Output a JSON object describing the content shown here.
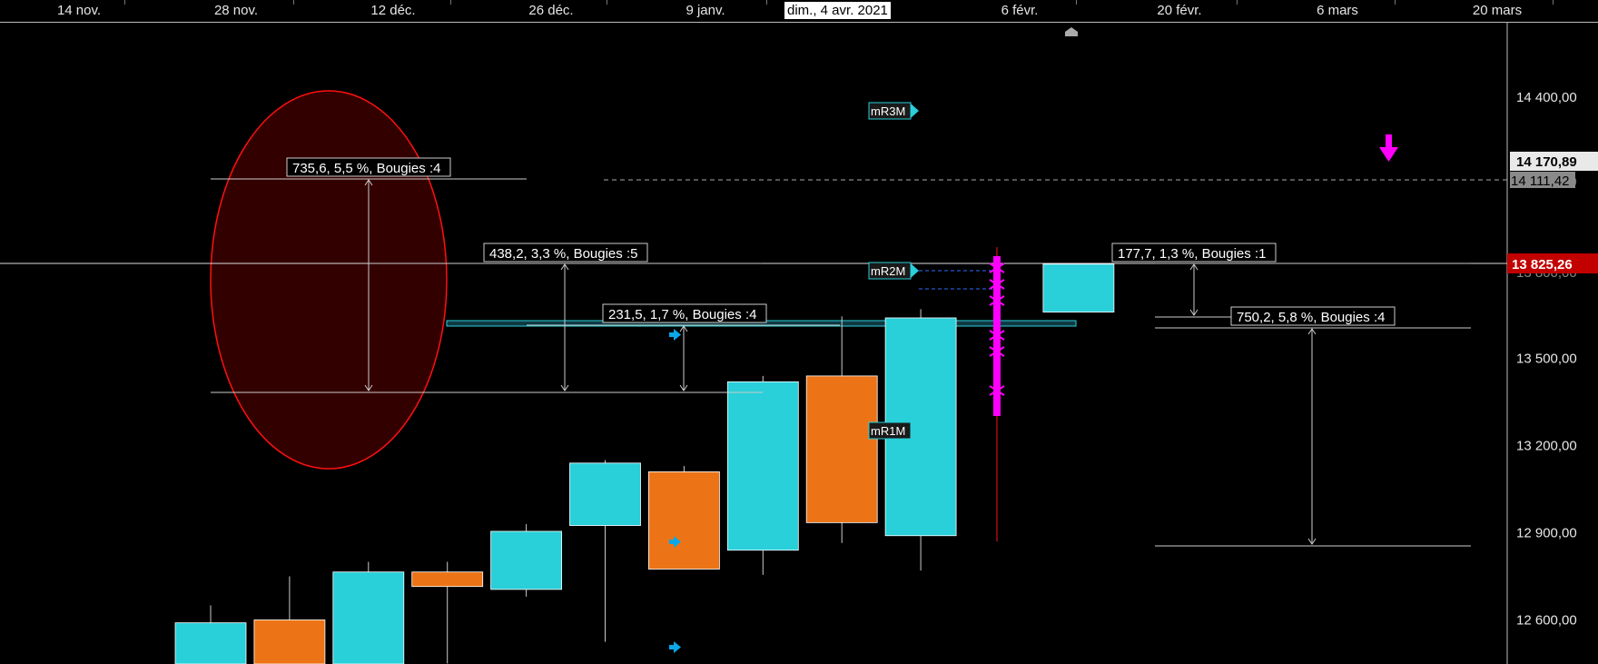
{
  "x_axis": {
    "ticks": [
      "14 nov.",
      "28 nov.",
      "12 déc.",
      "26 déc.",
      "9 janv.",
      "6 févr.",
      "20 févr.",
      "6 mars",
      "20 mars"
    ],
    "cursor_label": "dim., 4 avr. 2021"
  },
  "price_axis": {
    "current_price": "13 825,26",
    "high_label": "14 170,89",
    "dashed_label": "14 111,42",
    "partial_label": "13 800,00"
  },
  "colors": {
    "up": "#29cfd9",
    "down": "#ec7417",
    "ellipse": "#ff1010",
    "marker": "#ff00ff",
    "current_price_bg": "#c30000"
  },
  "chart_data": {
    "type": "candlestick",
    "ylim": [
      12420,
      14725
    ],
    "y_ticks": [
      "14 400,00",
      "13 500,00",
      "13 200,00",
      "12 900,00",
      "12 600,00"
    ],
    "y_tick_values": [
      14400,
      13500,
      13200,
      12900,
      12600
    ],
    "candles": [
      {
        "slot": 0,
        "open": 12420,
        "high": 12650,
        "low": 12420,
        "close": 12590,
        "dir": "up"
      },
      {
        "slot": 1,
        "open": 12600,
        "high": 12750,
        "low": 12420,
        "close": 12420,
        "dir": "down"
      },
      {
        "slot": 2,
        "open": 12420,
        "high": 12800,
        "low": 12420,
        "close": 12765,
        "dir": "up"
      },
      {
        "slot": 3,
        "open": 12765,
        "high": 12800,
        "low": 12450,
        "close": 12715,
        "dir": "down"
      },
      {
        "slot": 4,
        "open": 12705,
        "high": 12930,
        "low": 12680,
        "close": 12905,
        "dir": "up"
      },
      {
        "slot": 5,
        "open": 12925,
        "high": 13150,
        "low": 12525,
        "close": 13140,
        "dir": "up"
      },
      {
        "slot": 6,
        "open": 13110,
        "high": 13130,
        "low": 12790,
        "close": 12775,
        "dir": "down"
      },
      {
        "slot": 7,
        "open": 12840,
        "high": 13440,
        "low": 12755,
        "close": 13420,
        "dir": "up"
      },
      {
        "slot": 8,
        "open": 13440,
        "high": 13645,
        "low": 12865,
        "close": 12935,
        "dir": "down"
      },
      {
        "slot": 9,
        "open": 12890,
        "high": 13670,
        "low": 12770,
        "close": 13640,
        "dir": "up"
      },
      {
        "slot": 11,
        "open": 13660,
        "high": 13825,
        "low": 13660,
        "close": 13825,
        "dir": "up"
      }
    ],
    "current_price_value": 13825.26,
    "dashed_level": 14111.42,
    "measurements": [
      {
        "label": "735,6, 5,5 %, Bougies :4",
        "from": 13466,
        "to": 14201
      },
      {
        "label": "438,2, 3,3 %, Bougies :5",
        "from": 13466,
        "to": 13904
      },
      {
        "label": "231,5, 1,7 %, Bougies :4",
        "from": 13466,
        "to": 13697
      },
      {
        "label": "177,7, 1,3 %, Bougies :1",
        "from": 13648,
        "to": 13826
      },
      {
        "label": "750,2, 5,8 %, Bougies :4",
        "from": 12898,
        "to": 13648
      }
    ],
    "tags": [
      "mR3M",
      "mR2M",
      "mR1M"
    ]
  }
}
